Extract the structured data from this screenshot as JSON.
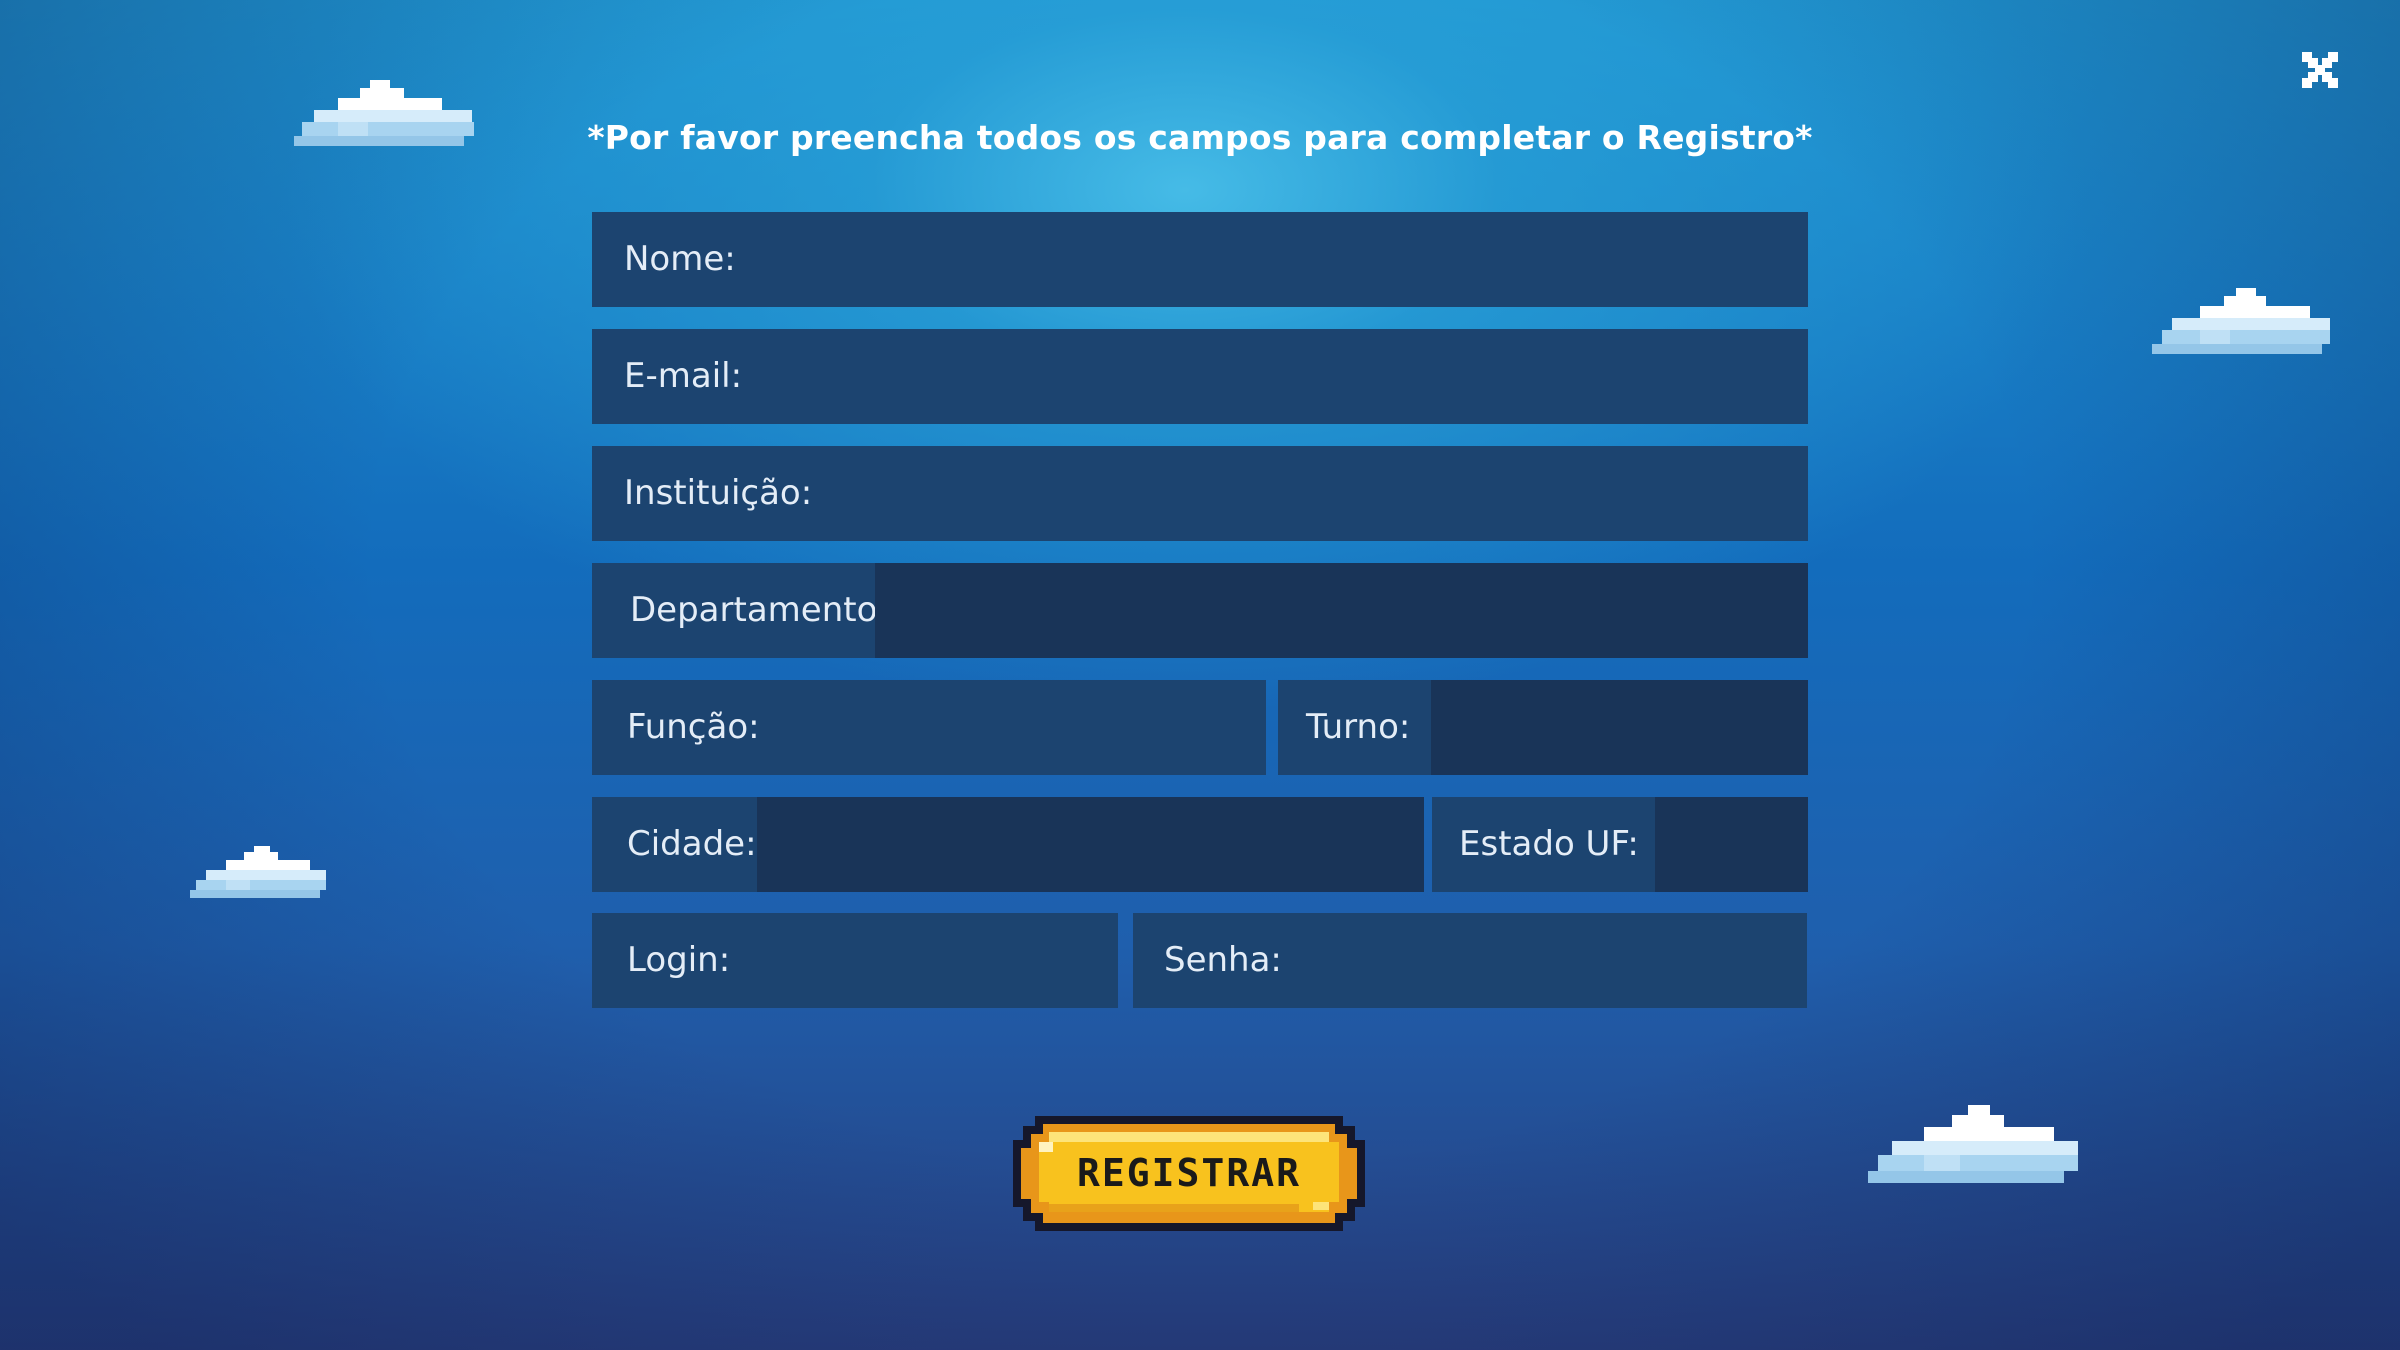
{
  "header": {
    "title": "*Por favor preencha todos os campos para completar o Registro*"
  },
  "close_icon": "close-icon",
  "form": {
    "nome": {
      "label": "Nome:",
      "value": ""
    },
    "email": {
      "label": "E-mail:",
      "value": ""
    },
    "instituicao": {
      "label": "Instituição:",
      "value": ""
    },
    "departamento": {
      "label": "Departamento:",
      "value": ""
    },
    "funcao": {
      "label": "Função:",
      "value": ""
    },
    "turno": {
      "label": "Turno:",
      "value": ""
    },
    "cidade": {
      "label": "Cidade:",
      "value": ""
    },
    "estado": {
      "label": "Estado UF:",
      "value": ""
    },
    "login": {
      "label": "Login:",
      "value": ""
    },
    "senha": {
      "label": "Senha:",
      "value": ""
    }
  },
  "register_button": {
    "label": "REGISTRAR"
  },
  "colors": {
    "field_bg": "#1c4470",
    "input_bg": "#193458",
    "button_yellow": "#f8c21e",
    "background_top": "#1f95d2",
    "background_bottom": "#283d7c"
  }
}
